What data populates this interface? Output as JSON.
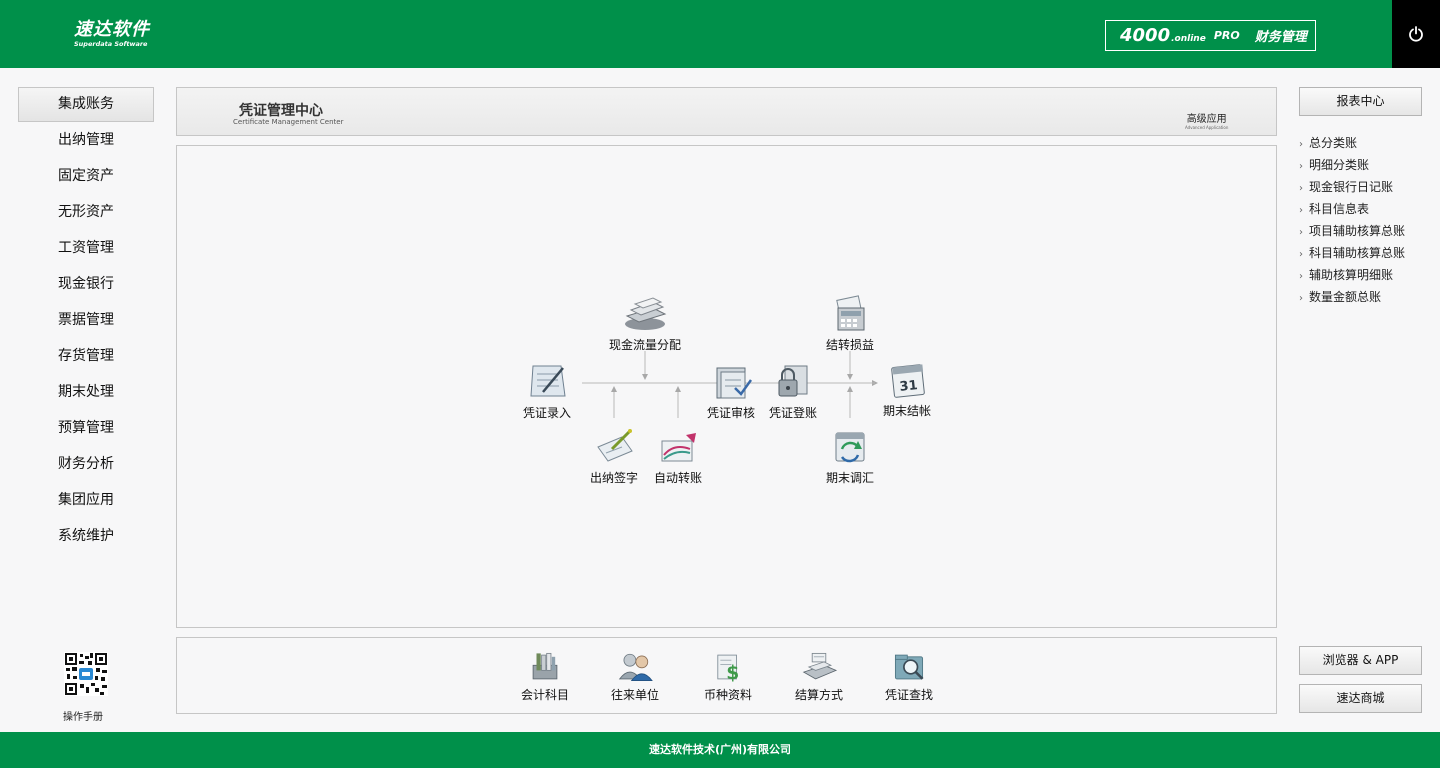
{
  "header": {
    "logo_cn": "速达软件",
    "logo_en": "Superdata Software",
    "product_num": "4000",
    "product_sub": ".online",
    "product_pro": "PRO",
    "product_name": "财务管理"
  },
  "left_nav": {
    "items": [
      {
        "label": "集成账务"
      },
      {
        "label": "出纳管理"
      },
      {
        "label": "固定资产"
      },
      {
        "label": "无形资产"
      },
      {
        "label": "工资管理"
      },
      {
        "label": "现金银行"
      },
      {
        "label": "票据管理"
      },
      {
        "label": "存货管理"
      },
      {
        "label": "期末处理"
      },
      {
        "label": "预算管理"
      },
      {
        "label": "财务分析"
      },
      {
        "label": "集团应用"
      },
      {
        "label": "系统维护"
      }
    ],
    "manual_label": "操作手册"
  },
  "title_panel": {
    "title_cn": "凭证管理中心",
    "title_en": "Certificate Management Center",
    "advanced_cn": "高级应用",
    "advanced_en": "Advanced Application"
  },
  "flow": {
    "voucher_entry": "凭证录入",
    "cash_flow": "现金流量分配",
    "cashier_sign": "出纳签字",
    "auto_transfer": "自动转账",
    "voucher_audit": "凭证审核",
    "voucher_post": "凭证登账",
    "carry_profit": "结转损益",
    "period_adjust": "期末调汇",
    "period_close": "期末结帐",
    "calendar_day": "31"
  },
  "tools": [
    {
      "label": "会计科目"
    },
    {
      "label": "往来单位"
    },
    {
      "label": "币种资料"
    },
    {
      "label": "结算方式"
    },
    {
      "label": "凭证查找"
    }
  ],
  "right": {
    "report_center": "报表中心",
    "report_items": [
      {
        "label": "总分类账"
      },
      {
        "label": "明细分类账"
      },
      {
        "label": "现金银行日记账"
      },
      {
        "label": "科目信息表"
      },
      {
        "label": "项目辅助核算总账"
      },
      {
        "label": "科目辅助核算总账"
      },
      {
        "label": "辅助核算明细账"
      },
      {
        "label": "数量金额总账"
      }
    ],
    "chevron": "›",
    "browser_app": "浏览器 & APP",
    "mall": "速达商城"
  },
  "footer": {
    "company": "速达软件技术(广州)有限公司"
  },
  "colors": {
    "brand_green": "#00904a",
    "power_bg": "#000000"
  }
}
